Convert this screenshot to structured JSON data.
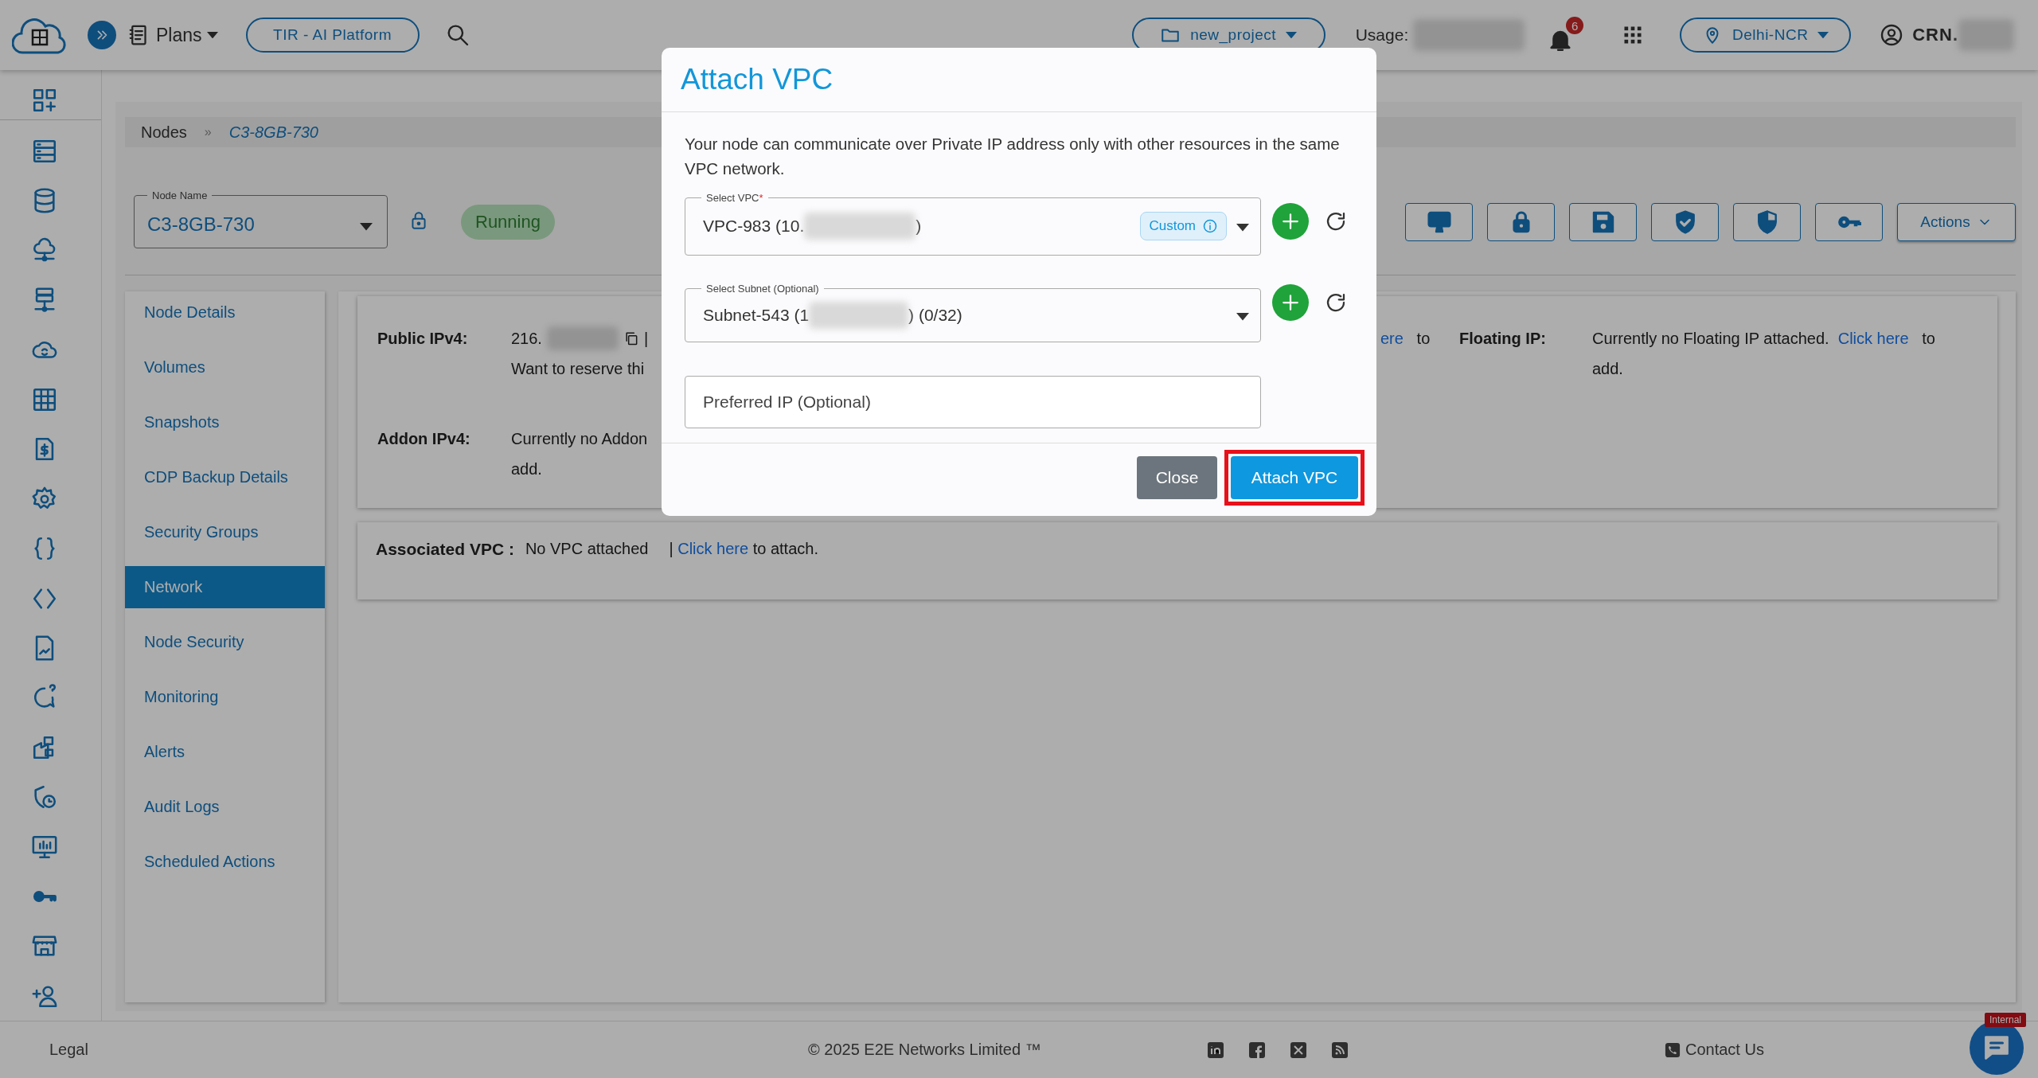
{
  "header": {
    "plans": "Plans",
    "platform_button": "TIR - AI Platform",
    "project": "new_project",
    "usage_label": "Usage:",
    "notification_count": "6",
    "region": "Delhi-NCR",
    "account": "CRN."
  },
  "breadcrumb_separator": "»",
  "breadcrumb": [
    {
      "label": "Nodes",
      "current": false
    },
    {
      "label": "C3-8GB-730",
      "current": true
    }
  ],
  "node_select": {
    "label": "Node Name",
    "value": "C3-8GB-730"
  },
  "status": "Running",
  "actions_button": "Actions",
  "nav": [
    {
      "label": "Node Details",
      "selected": false
    },
    {
      "label": "Volumes",
      "selected": false
    },
    {
      "label": "Snapshots",
      "selected": false
    },
    {
      "label": "CDP Backup Details",
      "selected": false
    },
    {
      "label": "Security Groups",
      "selected": false
    },
    {
      "label": "Network",
      "selected": true
    },
    {
      "label": "Node Security",
      "selected": false
    },
    {
      "label": "Monitoring",
      "selected": false
    },
    {
      "label": "Alerts",
      "selected": false
    },
    {
      "label": "Audit Logs",
      "selected": false
    },
    {
      "label": "Scheduled Actions",
      "selected": false
    }
  ],
  "network": {
    "public_ipv4": {
      "label": "Public IPv4:",
      "value": "216.",
      "separator": "|",
      "note": "Want to reserve thi"
    },
    "addon_ipv4": {
      "label": "Addon IPv4:",
      "text": "Currently no Addon",
      "continuation": "add."
    },
    "reserve_tail": {
      "link": "ere",
      "text": "to"
    },
    "floating_ip": {
      "label": "Floating IP:",
      "text": "Currently no Floating IP attached.",
      "link": "Click here",
      "suffix": "to",
      "continuation": "add."
    }
  },
  "associated_vpc": {
    "label": "Associated VPC :",
    "value": "No VPC attached",
    "prefix": "|",
    "link": "Click here",
    "suffix": "to attach."
  },
  "modal": {
    "title": "Attach VPC",
    "description": "Your node can communicate over Private IP address only with other resources in the same VPC network.",
    "vpc_field": {
      "label": "Select VPC",
      "required_mark": "*",
      "value_start": "VPC-983 (10.",
      "value_end": ")",
      "tag": "Custom"
    },
    "subnet_field": {
      "label": "Select Subnet (Optional)",
      "value_start": "Subnet-543 (1",
      "value_end": ") (0/32)"
    },
    "preferred_ip": {
      "placeholder": "Preferred IP (Optional)"
    },
    "buttons": [
      {
        "label": "Close",
        "kind": "secondary",
        "highlighted": false
      },
      {
        "label": "Attach VPC",
        "kind": "primary",
        "highlighted": true
      }
    ]
  },
  "footer": {
    "legal": "Legal",
    "copyright": "© 2025 E2E Networks Limited ™",
    "contact": "Contact Us",
    "chat_badge": "Internal"
  }
}
